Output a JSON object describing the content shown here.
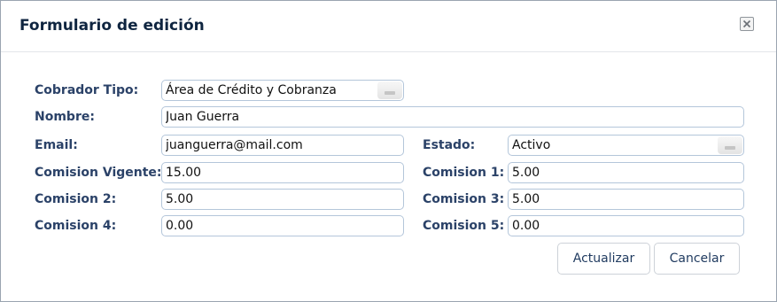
{
  "dialog": {
    "title": "Formulario de edición",
    "close_icon": "close-icon"
  },
  "form": {
    "cobrador_tipo": {
      "label": "Cobrador Tipo:",
      "value": "Área de Crédito y Cobranza"
    },
    "nombre": {
      "label": "Nombre:",
      "value": "Juan Guerra"
    },
    "email": {
      "label": "Email:",
      "value": "juanguerra@mail.com"
    },
    "estado": {
      "label": "Estado:",
      "value": "Activo"
    },
    "comision_vigente": {
      "label": "Comision Vigente:",
      "value": "15.00"
    },
    "comision_1": {
      "label": "Comision 1:",
      "value": "5.00"
    },
    "comision_2": {
      "label": "Comision 2:",
      "value": "5.00"
    },
    "comision_3": {
      "label": "Comision 3:",
      "value": "5.00"
    },
    "comision_4": {
      "label": "Comision 4:",
      "value": "0.00"
    },
    "comision_5": {
      "label": "Comision 5:",
      "value": "0.00"
    }
  },
  "buttons": {
    "update_label": "Actualizar",
    "cancel_label": "Cancelar"
  }
}
